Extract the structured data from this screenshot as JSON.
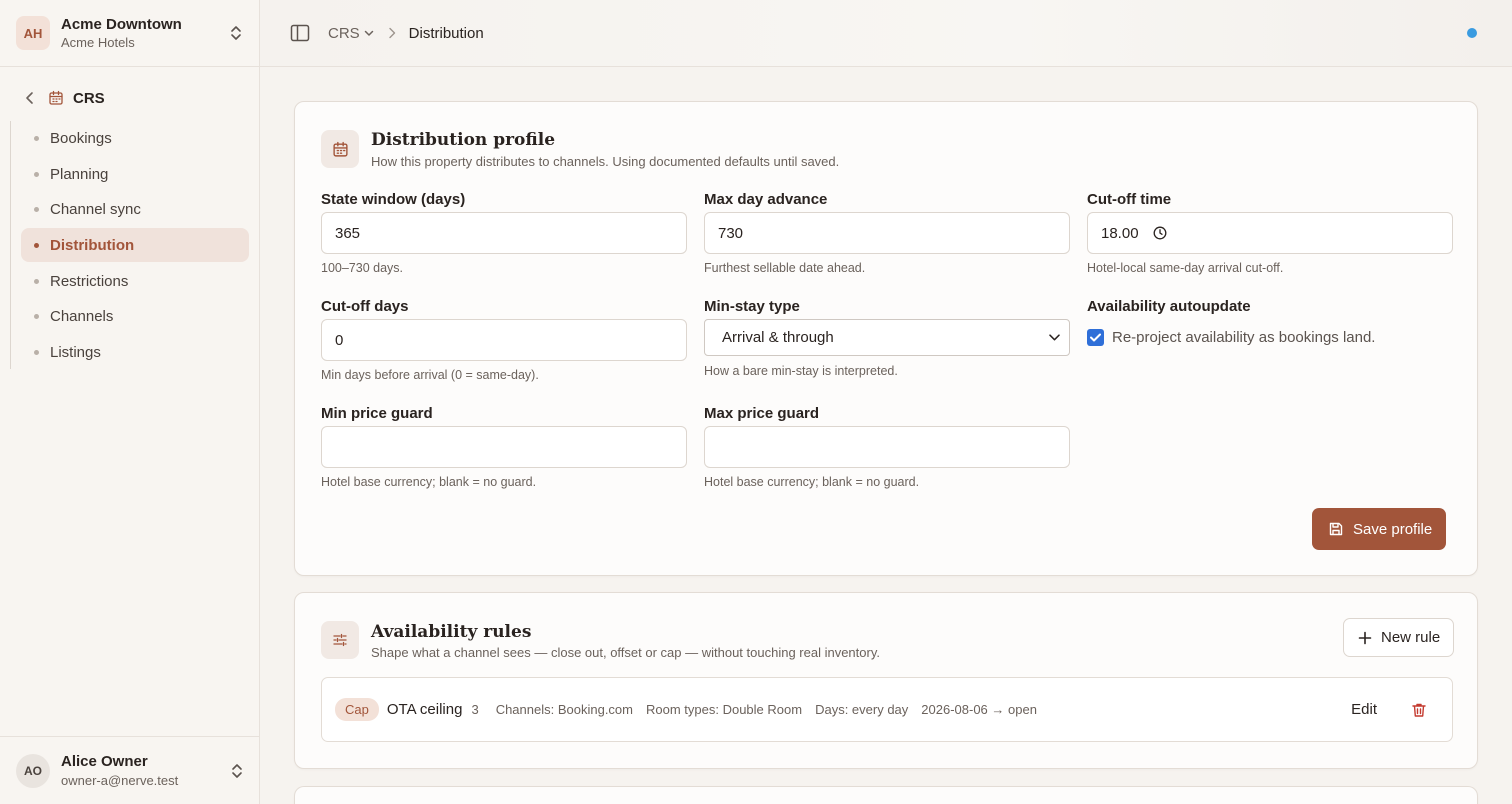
{
  "org": {
    "initials": "AH",
    "name": "Acme Downtown",
    "company": "Acme Hotels"
  },
  "sidebar": {
    "section": "CRS",
    "items": [
      {
        "label": "Bookings",
        "active": false
      },
      {
        "label": "Planning",
        "active": false
      },
      {
        "label": "Channel sync",
        "active": false
      },
      {
        "label": "Distribution",
        "active": true
      },
      {
        "label": "Restrictions",
        "active": false
      },
      {
        "label": "Channels",
        "active": false
      },
      {
        "label": "Listings",
        "active": false
      }
    ]
  },
  "user": {
    "initials": "AO",
    "name": "Alice Owner",
    "email": "owner-a@nerve.test"
  },
  "breadcrumb": {
    "parent": "CRS",
    "current": "Distribution"
  },
  "profile": {
    "title": "Distribution profile",
    "description": "How this property distributes to channels. Using documented defaults until saved.",
    "state_window": {
      "label": "State window (days)",
      "value": "365",
      "help": "100–730 days."
    },
    "max_day_advance": {
      "label": "Max day advance",
      "value": "730",
      "help": "Furthest sellable date ahead."
    },
    "cutoff_time": {
      "label": "Cut-off time",
      "value": "18.00",
      "help": "Hotel-local same-day arrival cut-off."
    },
    "cutoff_days": {
      "label": "Cut-off days",
      "value": "0",
      "help": "Min days before arrival (0 = same-day)."
    },
    "min_stay_type": {
      "label": "Min-stay type",
      "value": "Arrival & through",
      "help": "How a bare min-stay is interpreted."
    },
    "autoupdate": {
      "label": "Availability autoupdate",
      "checked": true,
      "checkbox_label": "Re-project availability as bookings land."
    },
    "min_price_guard": {
      "label": "Min price guard",
      "value": "",
      "help": "Hotel base currency; blank = no guard."
    },
    "max_price_guard": {
      "label": "Max price guard",
      "value": "",
      "help": "Hotel base currency; blank = no guard."
    },
    "save_label": "Save profile"
  },
  "rules": {
    "title": "Availability rules",
    "description": "Shape what a channel sees — close out, offset or cap — without touching real inventory.",
    "new_label": "New rule",
    "items": [
      {
        "type": "Cap",
        "name": "OTA ceiling",
        "count": "3",
        "channels": "Channels: Booking.com",
        "room_types": "Room types: Double Room",
        "days": "Days: every day",
        "dates": "2026-08-06 → open",
        "edit_label": "Edit"
      }
    ]
  },
  "colors": {
    "accent": "#a2553a",
    "status_dot": "#3a9be0",
    "checkbox": "#2f6fd8",
    "delete": "#c43a2f"
  }
}
